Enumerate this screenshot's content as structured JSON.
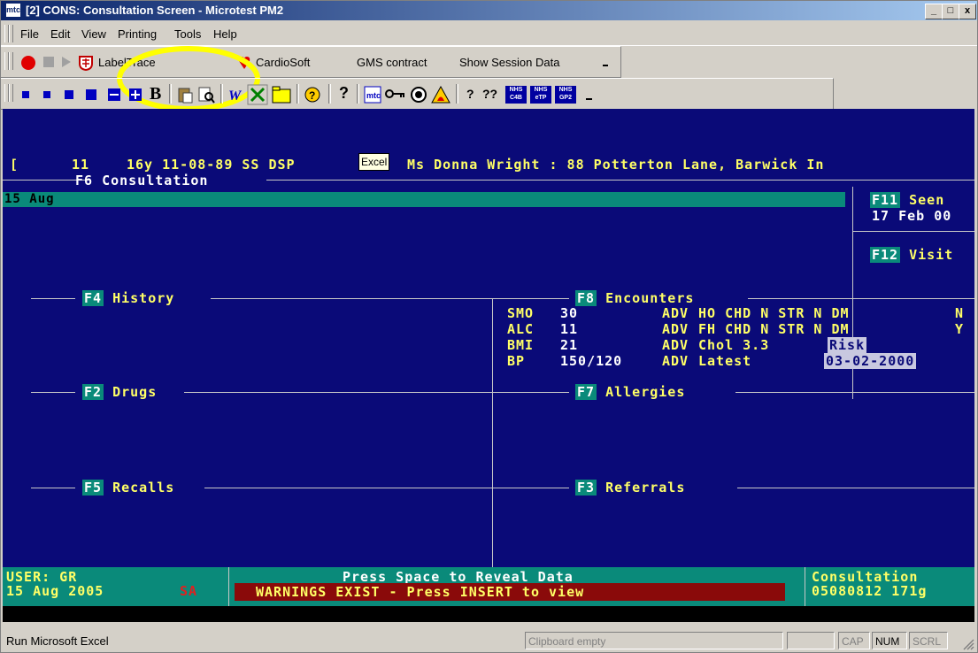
{
  "window": {
    "app_icon": "mtc",
    "title": "[2] CONS: Consultation Screen - Microtest PM2",
    "minimize": "_",
    "maximize": "□",
    "close": "x"
  },
  "menu": [
    "File",
    "Edit",
    "View",
    "Printing",
    "Tools",
    "Help"
  ],
  "toolbar1": {
    "labeltrace": "LabelTrace",
    "cardiosoft": "CardioSoft",
    "gms": "GMS contract",
    "session": "Show Session Data"
  },
  "toolbar2": {
    "bold": "B",
    "help": "?",
    "q1": "?",
    "q2": "??",
    "nhs1": "NHS\nC4B",
    "nhs2": "NHS\neTP",
    "nhs3": "NHS\nGP2"
  },
  "tooltip": "Excel",
  "terminal": {
    "header_bracket": "[",
    "header_num": "11",
    "header_left": "16y 11-08-89 SS DSP",
    "header_right": "Ms Donna Wright : 88 Potterton Lane, Barwick In",
    "f6_key": "F6",
    "f6_label": "Consultation",
    "date": "15 Aug",
    "f11_key": "F11",
    "f11_label": "Seen",
    "seen_date": "17 Feb 00",
    "f12_key": "F12",
    "f12_label": "Visit",
    "f4_key": "F4",
    "f4_label": "History",
    "f8_key": "F8",
    "f8_label": "Encounters",
    "encounters": [
      {
        "code": "SMO",
        "val": "30",
        "adv": "ADV",
        "text": "HO CHD N STR N DM",
        "end": "N"
      },
      {
        "code": "ALC",
        "val": "11",
        "adv": "ADV",
        "text": "FH CHD N STR N DM",
        "end": "Y"
      },
      {
        "code": "BMI",
        "val": "21",
        "adv": "ADV",
        "text": "Chol 3.3",
        "end": "Risk"
      },
      {
        "code": "BP",
        "val": "150/120",
        "adv": "ADV",
        "text": "Latest",
        "end": "03-02-2000"
      }
    ],
    "f2_key": "F2",
    "f2_label": "Drugs",
    "f7_key": "F7",
    "f7_label": "Allergies",
    "f5_key": "F5",
    "f5_label": "Recalls",
    "f3_key": "F3",
    "f3_label": "Referrals",
    "user": "USER: GR",
    "user_date": "15 Aug 2005",
    "sa": "SA",
    "press_space": "Press Space to Reveal Data",
    "warnings": "WARNINGS EXIST - Press INSERT to view",
    "consultation": "Consultation",
    "consultation_id": "05080812 171g"
  },
  "statusbar": {
    "message": "Run Microsoft Excel",
    "clipboard": "Clipboard empty",
    "cap": "CAP",
    "num": "NUM",
    "scrl": "SCRL"
  },
  "colors": {
    "terminal_bg": "#0a0a78",
    "highlight": "#ffff00",
    "key_bg": "#0a8a7a",
    "warning_bg": "#8a0a0a"
  }
}
